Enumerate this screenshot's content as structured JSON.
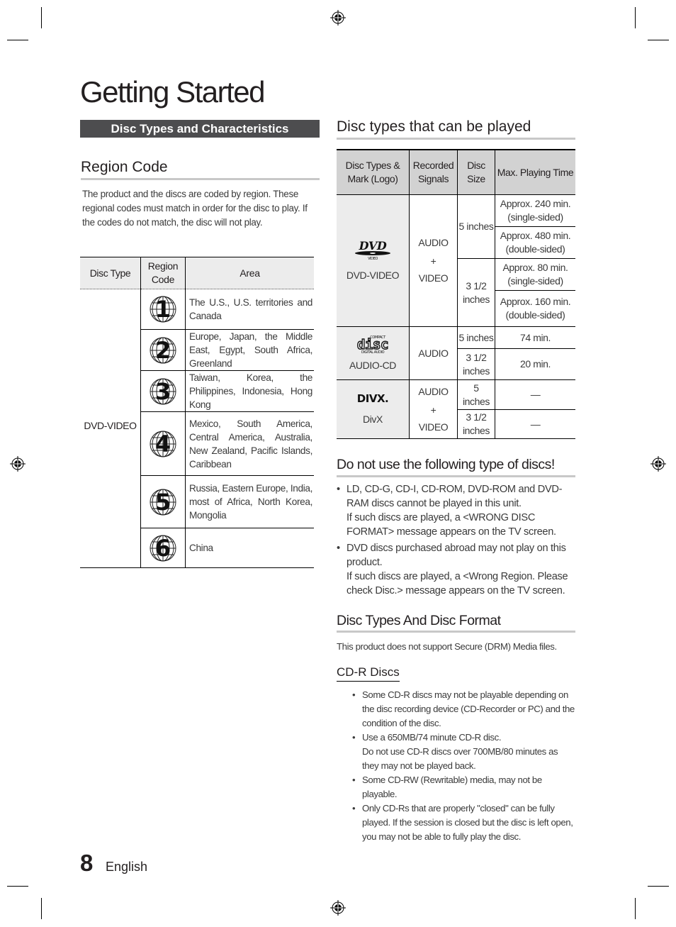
{
  "page": {
    "title": "Getting Started",
    "section_bar": "Disc Types and Characteristics",
    "page_number": "8",
    "language": "English"
  },
  "region_code": {
    "heading": "Region Code",
    "intro": "The product and the discs are coded by region. These regional codes must match in order for the disc to play. If the codes do not match, the disc will not play.",
    "table": {
      "headers": [
        "Disc Type",
        "Region Code",
        "Area"
      ],
      "disc_type": "DVD-VIDEO",
      "rows": [
        {
          "code": "1",
          "icon": "region-1-globe-icon",
          "area": "The U.S., U.S. territories and Canada"
        },
        {
          "code": "2",
          "icon": "region-2-globe-icon",
          "area": "Europe, Japan, the Middle East, Egypt, South Africa, Greenland"
        },
        {
          "code": "3",
          "icon": "region-3-globe-icon",
          "area": "Taiwan, Korea, the Philippines, Indonesia, Hong Kong"
        },
        {
          "code": "4",
          "icon": "region-4-globe-icon",
          "area": "Mexico, South America, Central America, Australia, New Zealand, Pacific Islands, Caribbean"
        },
        {
          "code": "5",
          "icon": "region-5-globe-icon",
          "area": "Russia, Eastern Europe, India, most of Africa, North Korea, Mongolia"
        },
        {
          "code": "6",
          "icon": "region-6-globe-icon",
          "area": "China"
        }
      ]
    }
  },
  "disc_types": {
    "heading": "Disc types that can be played",
    "headers": [
      "Disc Types & Mark (Logo)",
      "Recorded Signals",
      "Disc Size",
      "Max. Playing Time"
    ],
    "dvd": {
      "logo_icon": "dvd-video-logo-icon",
      "logo_sub": "VIDEO",
      "name": "DVD-VIDEO",
      "signals": [
        "AUDIO",
        "+",
        "VIDEO"
      ],
      "size_5": "5 inches",
      "size_35": "3 1/2 inches",
      "times": [
        "Approx. 240 min. (single-sided)",
        "Approx. 480 min. (double-sided)",
        "Approx. 80 min. (single-sided)",
        "Approx. 160 min. (double-sided)"
      ]
    },
    "cd": {
      "logo_icon": "compact-disc-digital-audio-logo-icon",
      "logo_top": "COMPACT",
      "logo_main": "disc",
      "logo_bottom": "DIGITAL AUDIO",
      "name": "AUDIO-CD",
      "signals": "AUDIO",
      "size_5": "5 inches",
      "size_35": "3 1/2 inches",
      "time_5": "74 min.",
      "time_35": "20 min."
    },
    "divx": {
      "logo_icon": "divx-logo-icon",
      "logo_text": "DIVX.",
      "name": "DivX",
      "signals": [
        "AUDIO",
        "+",
        "VIDEO"
      ],
      "size_5": "5 inches",
      "size_35": "3 1/2 inches",
      "time_5": "—",
      "time_35": "—"
    }
  },
  "do_not_use": {
    "heading": "Do not use the following type of discs!",
    "items": [
      {
        "line1": "LD, CD-G, CD-I, CD-ROM, DVD-ROM and DVD-RAM discs cannot be played in this unit.",
        "line2": "If such discs are played, a <WRONG DISC FORMAT> message appears on the TV screen."
      },
      {
        "line1": "DVD discs purchased abroad may not play on this product.",
        "line2": "If such discs are played, a <Wrong Region. Please check Disc.> message appears on the TV screen."
      }
    ]
  },
  "disc_format": {
    "heading": "Disc Types And Disc Format",
    "note": "This product does not support Secure (DRM) Media files.",
    "cdr": {
      "heading": "CD-R Discs",
      "items": [
        {
          "line1": "Some CD-R discs may not be playable depending on the disc recording device (CD-Recorder or PC) and the condition of the disc.",
          "line2": ""
        },
        {
          "line1": "Use a 650MB/74 minute CD-R disc.",
          "line2": "Do not use CD-R discs over 700MB/80 minutes as they may not be played back."
        },
        {
          "line1": "Some CD-RW (Rewritable) media, may not be playable.",
          "line2": ""
        },
        {
          "line1": "Only CD-Rs that are properly \"closed\" can be fully played. If the session is closed but the disc is left open, you may not be able to fully play the disc.",
          "line2": ""
        }
      ]
    }
  }
}
